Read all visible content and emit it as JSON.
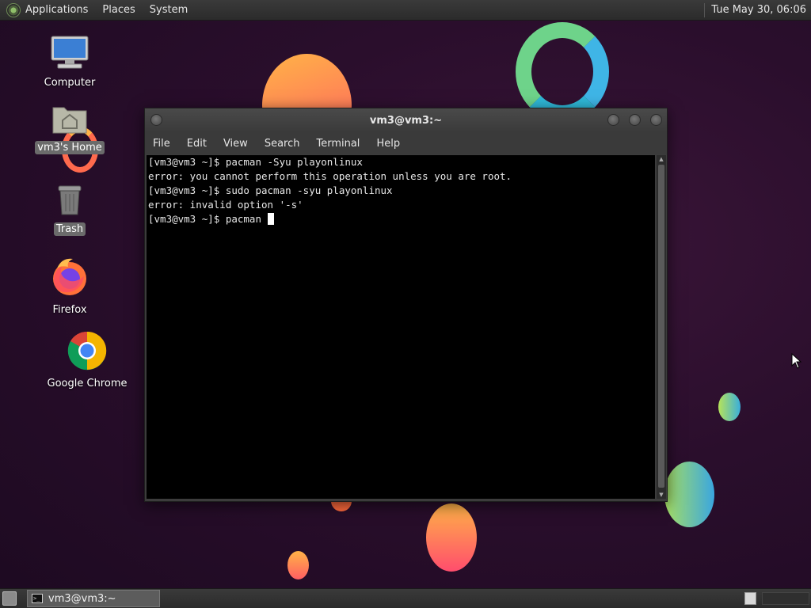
{
  "top_panel": {
    "menus": [
      "Applications",
      "Places",
      "System"
    ],
    "clock": "Tue May 30, 06:06"
  },
  "desktop_icons": [
    {
      "label": "Computer",
      "icon": "computer-icon"
    },
    {
      "label": "vm3's Home",
      "icon": "home-folder-icon",
      "selected": true
    },
    {
      "label": "Trash",
      "icon": "trash-icon"
    },
    {
      "label": "Firefox",
      "icon": "firefox-icon"
    },
    {
      "label": "Google Chrome",
      "icon": "chrome-icon"
    }
  ],
  "terminal": {
    "title": "vm3@vm3:~",
    "menu": [
      "File",
      "Edit",
      "View",
      "Search",
      "Terminal",
      "Help"
    ],
    "lines": [
      "[vm3@vm3 ~]$ pacman -Syu playonlinux",
      "error: you cannot perform this operation unless you are root.",
      "[vm3@vm3 ~]$ sudo pacman -syu playonlinux",
      "error: invalid option '-s'",
      "[vm3@vm3 ~]$ pacman "
    ]
  },
  "taskbar": {
    "window_button": "vm3@vm3:~"
  },
  "colors": {
    "background": "#2a0e2c",
    "panel": "#2f2f2f",
    "terminal_bg": "#000000",
    "terminal_fg": "#e8e8e8"
  }
}
